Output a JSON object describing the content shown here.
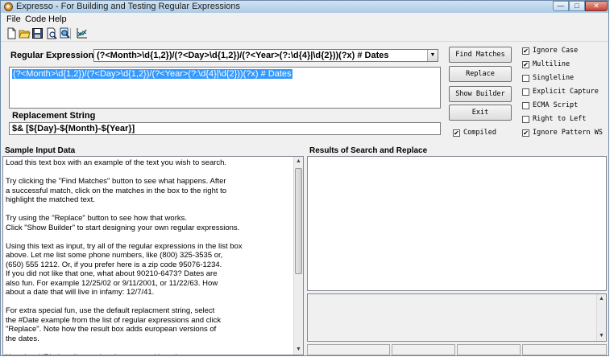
{
  "window": {
    "title": "Expresso - For Building and Testing Regular Expressions",
    "controls": {
      "minimize": "—",
      "maximize": "□",
      "close": "✕"
    }
  },
  "menu": [
    "File",
    "Code",
    "Help"
  ],
  "toolbar": {
    "icons": [
      "new-file-icon",
      "open-folder-icon",
      "save-disk-icon",
      "print-preview-icon",
      "search-icon",
      "chart-icon"
    ]
  },
  "regex": {
    "label": "Regular Expression",
    "selected": "(?<Month>\\d{1,2})/(?<Day>\\d{1,2})/(?<Year>(?:\\d{4}|\\d{2}))(?x)     # Dates",
    "edit_text": "(?<Month>\\d{1,2})/(?<Day>\\d{1,2})/(?<Year>(?:\\d{4}|\\d{2}))(?x)     # Dates"
  },
  "replacement": {
    "label": "Replacement String",
    "value": "$& [${Day}-${Month}-${Year}]"
  },
  "buttons": {
    "find_matches": "Find Matches",
    "replace": "Replace",
    "show_builder": "Show Builder",
    "exit": "Exit"
  },
  "options": {
    "compiled": {
      "label": "Compiled",
      "checked": true
    },
    "ignore_case": {
      "label": "Ignore Case",
      "checked": true
    },
    "multiline": {
      "label": "Multiline",
      "checked": true
    },
    "singleline": {
      "label": "Singleline",
      "checked": false
    },
    "explicit_capture": {
      "label": "Explicit Capture",
      "checked": false
    },
    "ecma_script": {
      "label": "ECMA Script",
      "checked": false
    },
    "right_to_left": {
      "label": "Right to Left",
      "checked": false
    },
    "ignore_pattern_ws": {
      "label": "Ignore Pattern WS",
      "checked": true
    }
  },
  "sample": {
    "label": "Sample Input Data",
    "lines": [
      "Load this text box with an example of the text you wish to search.",
      "",
      "Try clicking the \"Find Matches\" button to see what happens. After",
      "a successful match, click on the matches in the box to the right to",
      "highlight the matched text.",
      "",
      "Try using the \"Replace\" button to see how that works.",
      "Click \"Show Builder\" to start designing your own regular expressions.",
      "",
      "Using this text as input, try all of the regular expressions in the list box",
      "above. Let me list some phone numbers, like (800) 325-3535 or,",
      "(650) 555 1212. Or, if you prefer here is a zip code 95076-1234.",
      "If you did not like that one, what about 90210-6473? Dates are",
      "also fun. For example 12/25/02 or 9/11/2001, or 11/22/63.  How",
      "about a date that will live in infamy: 12/7/41.",
      "",
      "For extra special fun, use the default replacment string, select",
      "the #Date example from the list of regular expressions and click",
      "\"Replace\". Note how the result box adds european versions of",
      "the dates.",
      "",
      "Here is a URL: http://www.ultrapico.com and here is"
    ]
  },
  "results": {
    "label": "Results of Search and Replace"
  }
}
